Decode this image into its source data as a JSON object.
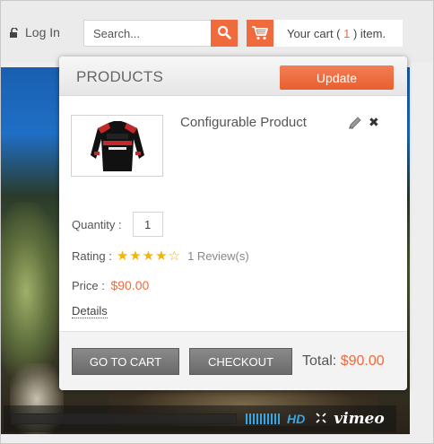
{
  "header": {
    "login_label": "Log In",
    "search": {
      "placeholder": "Search...",
      "value": ""
    },
    "cart": {
      "prefix": "Your cart ( ",
      "count": "1",
      "suffix": " ) item."
    }
  },
  "video": {
    "player_brand": "vimeo",
    "hd_label": "HD"
  },
  "cart_panel": {
    "title": "PRODUCTS",
    "update_label": "Update",
    "product": {
      "name": "Configurable Product",
      "quantity_label": "Quantity :",
      "quantity_value": "1",
      "rating_label": "Rating :",
      "rating_stars": 4,
      "rating_max": 5,
      "reviews_label": "1 Review(s)",
      "price_label": "Price :",
      "price_value": "$90.00",
      "details_label": "Details"
    },
    "go_to_cart_label": "GO TO CART",
    "checkout_label": "CHECKOUT",
    "total_label": "Total:",
    "total_value": "$90.00"
  },
  "colors": {
    "accent": "#ef6a3c",
    "button_gray": "#7a7a7a",
    "star": "#f4b400"
  },
  "icons": [
    "lock-icon",
    "search-icon",
    "cart-icon",
    "edit-icon",
    "remove-icon",
    "star-icon",
    "fullscreen-icon"
  ]
}
